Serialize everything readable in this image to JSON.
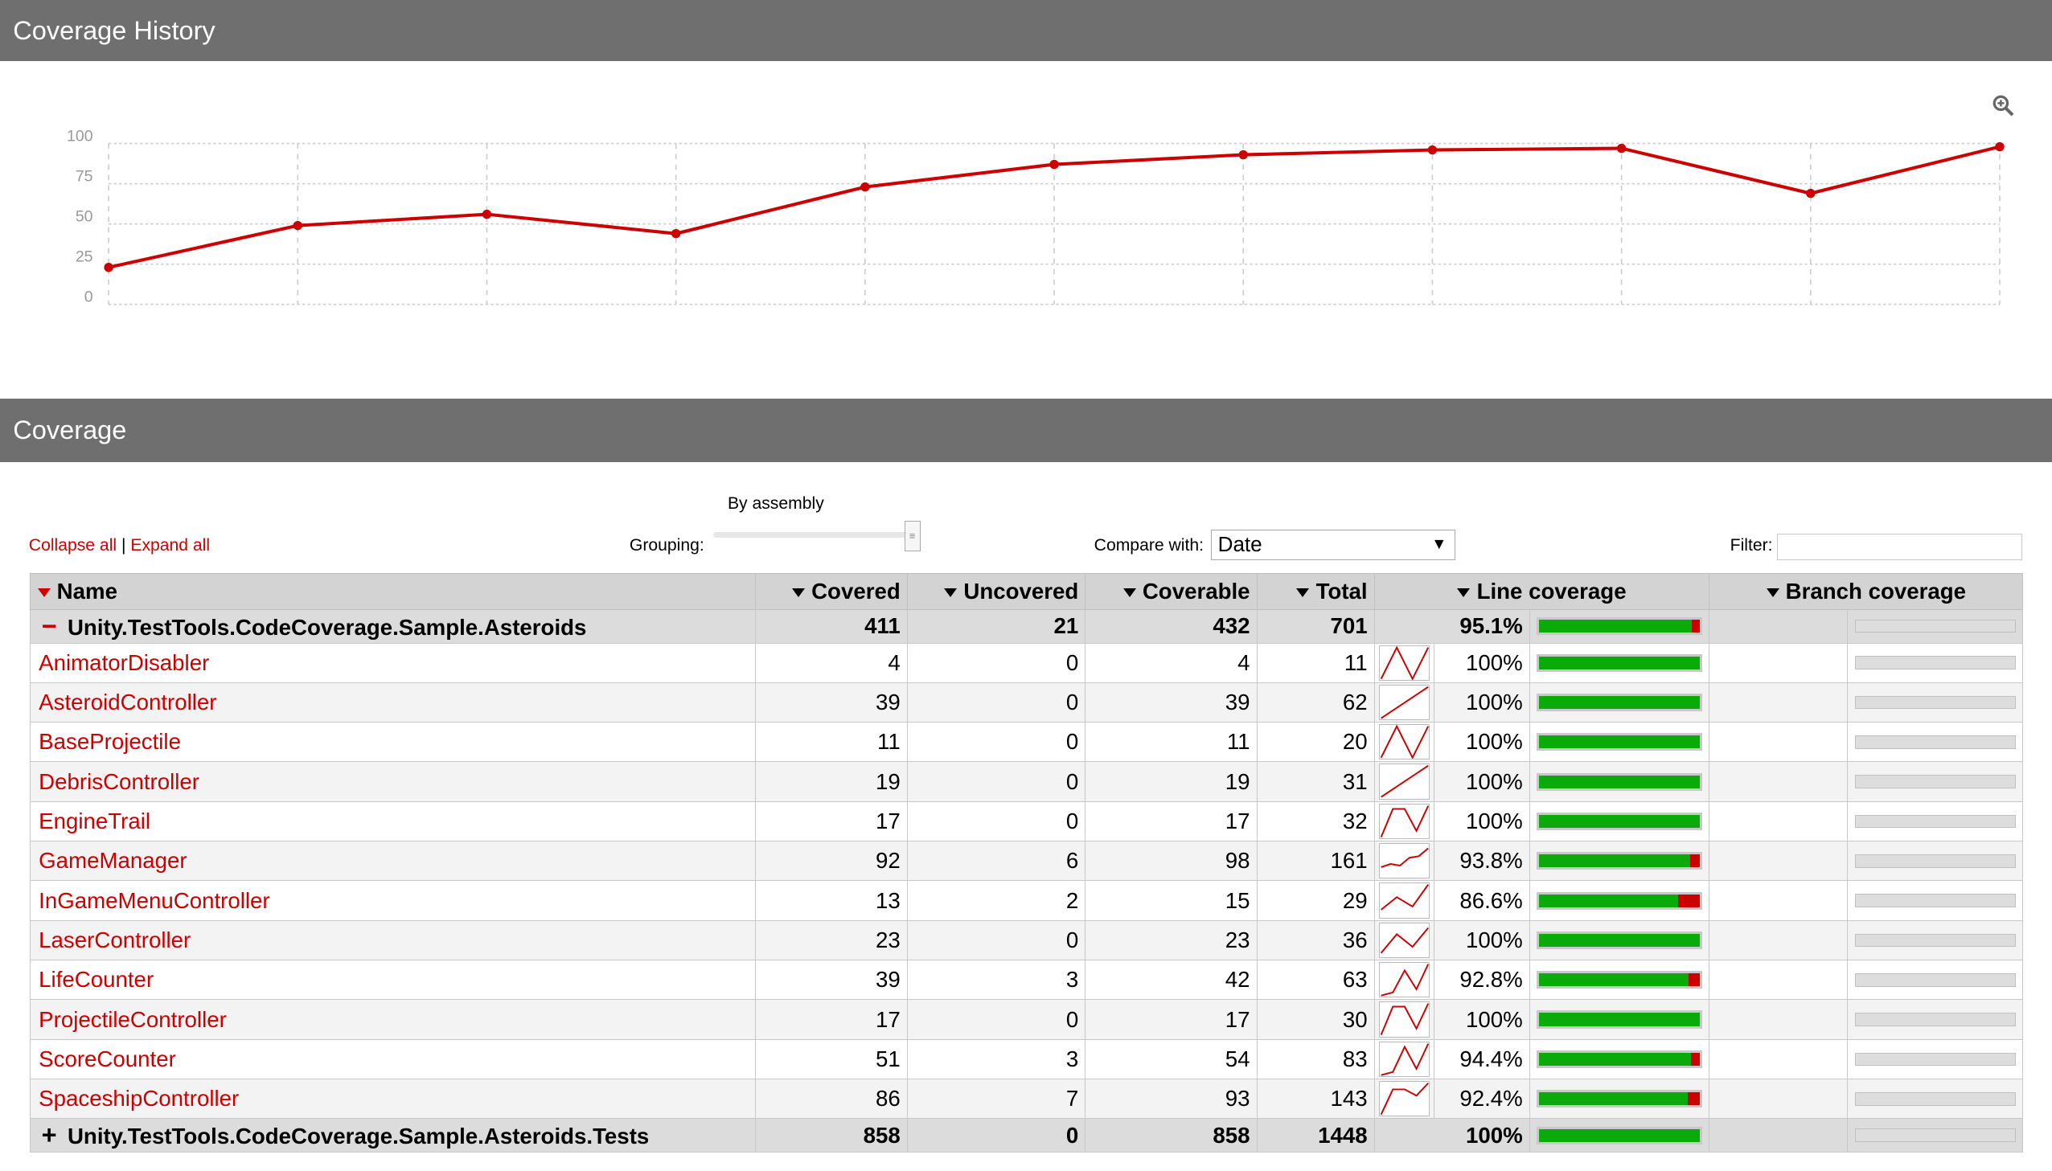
{
  "history": {
    "title": "Coverage History",
    "zoom_icon": "zoom-in-icon"
  },
  "chart_data": {
    "type": "line",
    "title": "",
    "xlabel": "",
    "ylabel": "",
    "ylim": [
      0,
      100
    ],
    "yticks": [
      "0",
      "25",
      "50",
      "75",
      "100"
    ],
    "grid": true,
    "color": "#cc0000",
    "x": [
      1,
      2,
      3,
      4,
      5,
      6,
      7,
      8,
      9,
      10,
      11
    ],
    "values": [
      23,
      49,
      56,
      44,
      73,
      87,
      93,
      96,
      97,
      69,
      98
    ]
  },
  "coverage": {
    "title": "Coverage"
  },
  "controls": {
    "collapse_all": "Collapse all",
    "separator": "|",
    "expand_all": "Expand all",
    "grouping_label": "Grouping:",
    "grouping_value": "By assembly",
    "compare_label": "Compare with:",
    "compare_value": "Date",
    "filter_label": "Filter:",
    "filter_value": ""
  },
  "table": {
    "headers": [
      "Name",
      "Covered",
      "Uncovered",
      "Coverable",
      "Total",
      "Line coverage",
      "Branch coverage"
    ],
    "groups": [
      {
        "name": "Unity.TestTools.CodeCoverage.Sample.Asteroids",
        "expanded": true,
        "covered": "411",
        "uncovered": "21",
        "coverable": "432",
        "total": "701",
        "pct": "95.1%",
        "fraction": 0.951
      },
      {
        "name": "Unity.TestTools.CodeCoverage.Sample.Asteroids.Tests",
        "expanded": false,
        "covered": "858",
        "uncovered": "0",
        "coverable": "858",
        "total": "1448",
        "pct": "100%",
        "fraction": 1.0
      }
    ],
    "rows": [
      {
        "name": "AnimatorDisabler",
        "covered": "4",
        "uncovered": "0",
        "coverable": "4",
        "total": "11",
        "pct": "100%",
        "fraction": 1.0,
        "history": [
          0,
          1,
          0,
          1
        ]
      },
      {
        "name": "AsteroidController",
        "covered": "39",
        "uncovered": "0",
        "coverable": "39",
        "total": "62",
        "pct": "100%",
        "fraction": 1.0,
        "history": [
          0,
          1
        ]
      },
      {
        "name": "BaseProjectile",
        "covered": "11",
        "uncovered": "0",
        "coverable": "11",
        "total": "20",
        "pct": "100%",
        "fraction": 1.0,
        "history": [
          0,
          1,
          0,
          1
        ]
      },
      {
        "name": "DebrisController",
        "covered": "19",
        "uncovered": "0",
        "coverable": "19",
        "total": "31",
        "pct": "100%",
        "fraction": 1.0,
        "history": [
          0,
          1
        ]
      },
      {
        "name": "EngineTrail",
        "covered": "17",
        "uncovered": "0",
        "coverable": "17",
        "total": "32",
        "pct": "100%",
        "fraction": 1.0,
        "history": [
          0,
          0.9,
          0.9,
          0.2,
          1
        ]
      },
      {
        "name": "GameManager",
        "covered": "92",
        "uncovered": "6",
        "coverable": "98",
        "total": "161",
        "pct": "93.8%",
        "fraction": 0.938,
        "history": [
          0.3,
          0.4,
          0.35,
          0.6,
          0.65,
          0.9
        ]
      },
      {
        "name": "InGameMenuController",
        "covered": "13",
        "uncovered": "2",
        "coverable": "15",
        "total": "29",
        "pct": "86.6%",
        "fraction": 0.866,
        "history": [
          0.2,
          0.6,
          0.3,
          1
        ]
      },
      {
        "name": "LaserController",
        "covered": "23",
        "uncovered": "0",
        "coverable": "23",
        "total": "36",
        "pct": "100%",
        "fraction": 1.0,
        "history": [
          0.1,
          0.7,
          0.3,
          0.9
        ]
      },
      {
        "name": "LifeCounter",
        "covered": "39",
        "uncovered": "3",
        "coverable": "42",
        "total": "63",
        "pct": "92.8%",
        "fraction": 0.928,
        "history": [
          0,
          0.1,
          0.8,
          0.2,
          1
        ]
      },
      {
        "name": "ProjectileController",
        "covered": "17",
        "uncovered": "0",
        "coverable": "17",
        "total": "30",
        "pct": "100%",
        "fraction": 1.0,
        "history": [
          0,
          0.9,
          0.9,
          0.2,
          1
        ]
      },
      {
        "name": "ScoreCounter",
        "covered": "51",
        "uncovered": "3",
        "coverable": "54",
        "total": "83",
        "pct": "94.4%",
        "fraction": 0.944,
        "history": [
          0,
          0.1,
          0.9,
          0.2,
          1
        ]
      },
      {
        "name": "SpaceshipController",
        "covered": "86",
        "uncovered": "7",
        "coverable": "93",
        "total": "143",
        "pct": "92.4%",
        "fraction": 0.924,
        "history": [
          0,
          0.8,
          0.8,
          0.6,
          1
        ]
      }
    ]
  },
  "colors": {
    "header_bar": "#6f6f6f",
    "accent": "#cc0000",
    "covered": "#0aaa0a",
    "uncovered": "#cc0000"
  }
}
